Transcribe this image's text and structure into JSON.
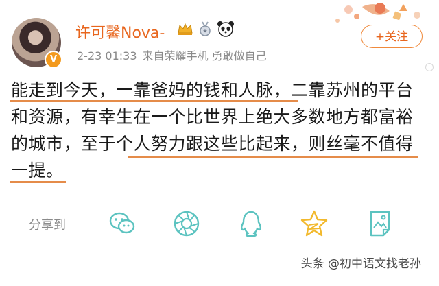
{
  "header": {
    "username": "许可馨Nova-",
    "verified_badge": "V",
    "timestamp": "2-23 01:33",
    "source": "来自荣耀手机 勇敢做自己",
    "follow_label": "+关注"
  },
  "post": {
    "line1": "能走到今天，一靠爸妈的钱和人脉，二靠苏州的平台",
    "line2": "和资源，有幸生在一个比世界上绝大多数地方都富裕",
    "line3": "的城市，至于个人努力跟这些比起来，则丝毫不值得",
    "line4": "一提。"
  },
  "share": {
    "label": "分享到",
    "icons": [
      "wechat-icon",
      "moments-icon",
      "qq-icon",
      "qzone-icon",
      "save-image-icon"
    ]
  },
  "footer": {
    "brand": "头条 @初中语文找老孙"
  },
  "colors": {
    "accent": "#e8661e",
    "underline": "#e58c4a",
    "share_icon": "#5cc3c0",
    "qzone_icon": "#f2b92d"
  }
}
